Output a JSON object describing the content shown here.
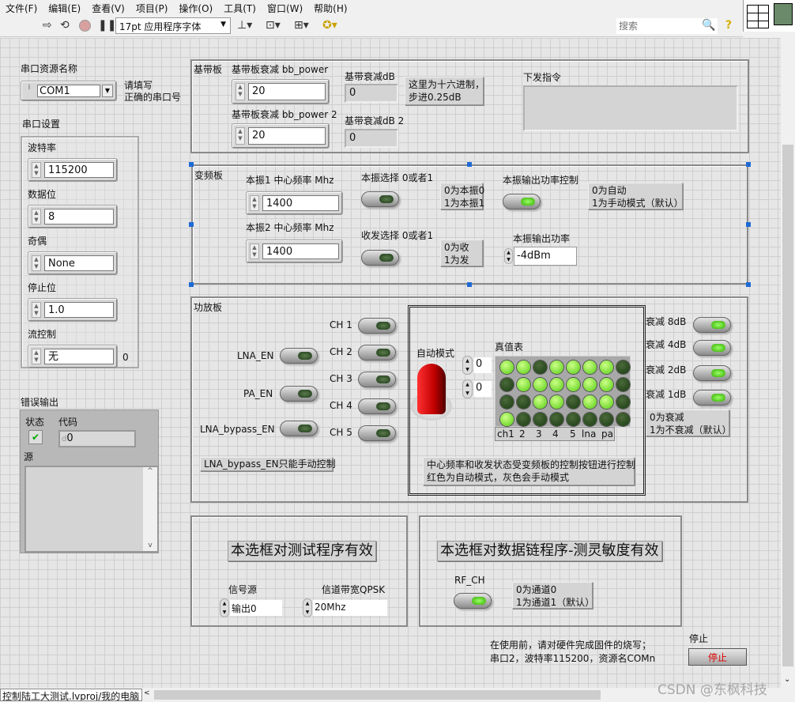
{
  "menu": [
    "文件(F)",
    "编辑(E)",
    "查看(V)",
    "项目(P)",
    "操作(O)",
    "工具(T)",
    "窗口(W)",
    "帮助(H)"
  ],
  "toolbar": {
    "font": "17pt 应用程序字体",
    "search_placeholder": "搜索",
    "icons": [
      "run-arrow",
      "run-continuous",
      "abort-stop",
      "pause",
      "align",
      "distribute",
      "resize",
      "reorder",
      "search",
      "help"
    ]
  },
  "serial": {
    "resource_label": "串口资源名称",
    "resource_value": "COM1",
    "resource_note": "请填写\n正确的串口号",
    "settings_label": "串口设置",
    "fields": [
      {
        "label": "波特率",
        "value": "115200"
      },
      {
        "label": "数据位",
        "value": "8"
      },
      {
        "label": "奇偶",
        "value": "None"
      },
      {
        "label": "停止位",
        "value": "1.0"
      },
      {
        "label": "流控制",
        "value": "无"
      }
    ],
    "flow_extra": "0"
  },
  "error": {
    "label": "错误输出",
    "status_label": "状态",
    "code_label": "代码",
    "code_prefix": "d",
    "code_value": "0",
    "source_label": "源",
    "source_value": ""
  },
  "baseband": {
    "label": "基带板",
    "ctrl1_label": "基带板衰减 bb_power",
    "ctrl1_value": "20",
    "ind1_label": "基带衰减dB",
    "ind1_value": "0",
    "note": "这里为十六进制，\n步进0.25dB",
    "ctrl2_label": "基带板衰减 bb_power 2",
    "ctrl2_value": "20",
    "ind2_label": "基带衰减dB 2",
    "ind2_value": "0",
    "cmd_label": "下发指令",
    "cmd_value": ""
  },
  "freq": {
    "label": "变频板",
    "lo1_label": "本振1 中心频率 Mhz",
    "lo1_value": "1400",
    "lo2_label": "本振2 中心频率 Mhz",
    "lo2_value": "1400",
    "lo_sel_label": "本振选择 0或者1",
    "lo_sel_note": "0为本振0\n1为本振1",
    "trx_sel_label": "收发选择 0或者1",
    "trx_sel_note": "0为收\n1为发",
    "pwr_ctrl_label": "本振输出功率控制",
    "pwr_ctrl_note": "0为自动\n1为手动模式（默认）",
    "pwr_label": "本振输出功率",
    "pwr_value": "-4dBm"
  },
  "pa": {
    "label": "功放板",
    "channels": [
      "CH 1",
      "CH 2",
      "CH 3",
      "CH 4",
      "CH 5"
    ],
    "lna_en": "LNA_EN",
    "pa_en": "PA_EN",
    "lna_bypass": "LNA_bypass_EN",
    "bypass_note": "LNA_bypass_EN只能手动控制",
    "auto_label": "自动模式",
    "auto_num1": "0",
    "auto_num2": "0",
    "truth_label": "真值表",
    "truth_table": [
      [
        1,
        1,
        0,
        1,
        1,
        1,
        1,
        0
      ],
      [
        0,
        1,
        1,
        1,
        1,
        1,
        1,
        0
      ],
      [
        0,
        0,
        1,
        1,
        0,
        1,
        1,
        0
      ],
      [
        1,
        0,
        0,
        0,
        0,
        0,
        0,
        0
      ]
    ],
    "truth_cols": [
      "ch1",
      "2",
      "3",
      "4",
      "5",
      "lna",
      "pa"
    ],
    "auto_note": "中心频率和收发状态受变频板的控制按钮进行控制\n红色为自动模式，灰色会手动模式",
    "atten": [
      "衰减 8dB",
      "衰减 4dB",
      "衰减 2dB",
      "衰减 1dB"
    ],
    "atten_note": "0为衰减\n1为不衰减（默认）"
  },
  "test": {
    "title": "本选框对测试程序有效",
    "src_label": "信号源",
    "src_value": "输出0",
    "bw_label": "信道带宽QPSK",
    "bw_value": "20Mhz"
  },
  "datalink": {
    "title": "本选框对数据链程序-测灵敏度有效",
    "rf_label": "RF_CH",
    "rf_note": "0为通道0\n1为通道1（默认）"
  },
  "footer": {
    "instructions": "在使用前，请对硬件完成固件的烧写；\n串口2，波特率115200，资源名COMn",
    "stop_label": "停止",
    "stop_button": "停止",
    "status": "控制陆工大测试.lvproj/我的电脑",
    "watermark": "CSDN @东枫科技"
  },
  "colors": {
    "led_on": "#66dd11",
    "led_off": "#1a3a12",
    "stop_text": "#e00000",
    "boolean_red": "#dd0000",
    "selection": "#1e6bd6"
  }
}
